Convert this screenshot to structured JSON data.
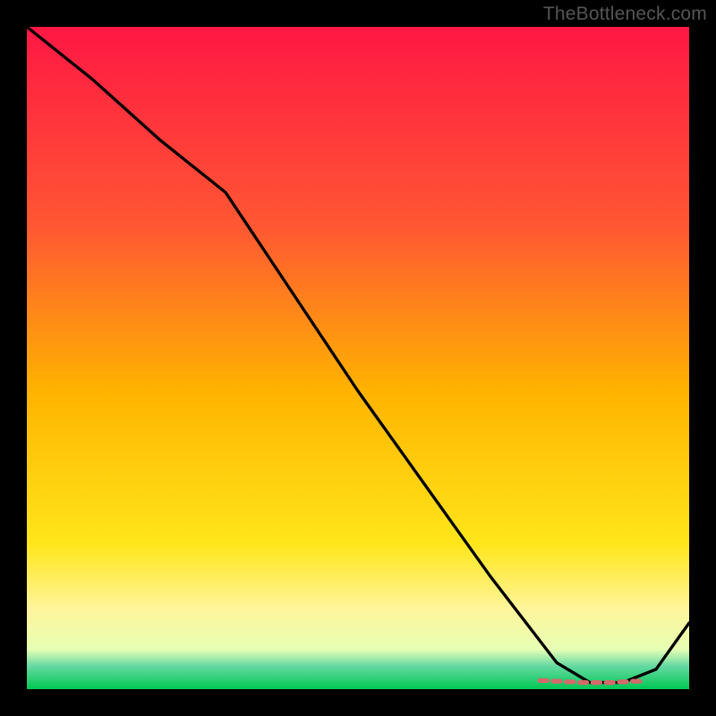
{
  "watermark": "TheBottleneck.com",
  "chart_data": {
    "type": "line",
    "title": "",
    "xlabel": "",
    "ylabel": "",
    "xlim": [
      0,
      100
    ],
    "ylim": [
      0,
      100
    ],
    "background": {
      "type": "vertical-gradient",
      "description": "Smooth vertical gradient: red on the upper portion, through orange and yellow in the middle/lower area, pale yellow, then narrow bands of teal and green at the very bottom.",
      "stops": [
        {
          "offset": 0.0,
          "color": "#ff1744"
        },
        {
          "offset": 0.3,
          "color": "#ff5733"
        },
        {
          "offset": 0.55,
          "color": "#ffb300"
        },
        {
          "offset": 0.78,
          "color": "#ffe61a"
        },
        {
          "offset": 0.88,
          "color": "#fff59d"
        },
        {
          "offset": 0.94,
          "color": "#e6ffb3"
        },
        {
          "offset": 0.965,
          "color": "#66d9a3"
        },
        {
          "offset": 1.0,
          "color": "#00c853"
        }
      ]
    },
    "series": [
      {
        "name": "bottleneck-curve",
        "color": "#000000",
        "x": [
          0,
          10,
          20,
          30,
          40,
          50,
          60,
          70,
          80,
          85,
          90,
          95,
          100
        ],
        "y": [
          100,
          92,
          83,
          75,
          60,
          45,
          31,
          17,
          4,
          1,
          1,
          3,
          10
        ]
      }
    ],
    "markers": {
      "name": "bottom-dots",
      "color": "#d46a6a",
      "shape": "rounded-dash",
      "x": [
        78,
        80,
        82,
        84,
        86,
        88,
        90,
        92
      ],
      "y": [
        1.3,
        1.2,
        1.1,
        1.0,
        1.0,
        1.0,
        1.1,
        1.2
      ]
    }
  }
}
